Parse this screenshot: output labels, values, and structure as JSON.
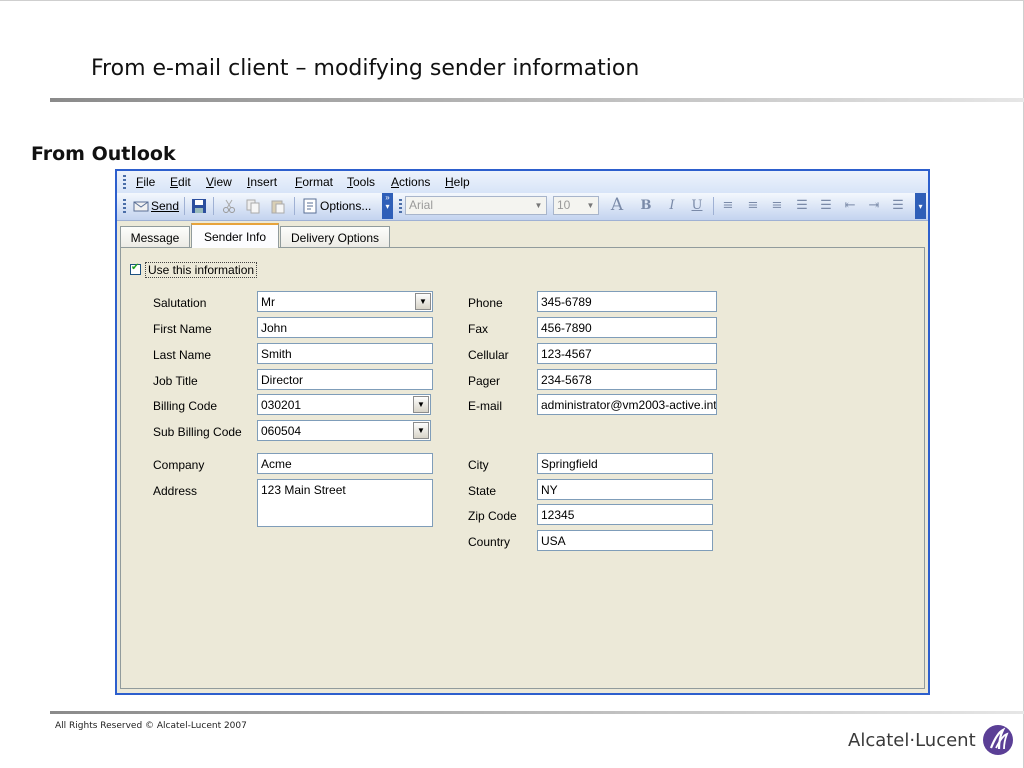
{
  "slide": {
    "title": "From e-mail client – modifying sender information",
    "section_heading": "From Outlook",
    "footer": {
      "copyright": "All Rights Reserved © Alcatel-Lucent 2007",
      "brand": "Alcatel·Lucent"
    }
  },
  "menubar": {
    "items": [
      {
        "label": "File"
      },
      {
        "label": "Edit"
      },
      {
        "label": "View"
      },
      {
        "label": "Insert"
      },
      {
        "label": "Format"
      },
      {
        "label": "Tools"
      },
      {
        "label": "Actions"
      },
      {
        "label": "Help"
      }
    ]
  },
  "toolbar": {
    "send_label": "Send",
    "options_label": "Options...",
    "font_name": "Arial",
    "font_size": "10",
    "format_icons": [
      "font-color-icon",
      "bold-icon",
      "italic-icon",
      "underline-icon",
      "align-left-icon",
      "align-center-icon",
      "align-right-icon",
      "bullets-icon",
      "numbering-icon",
      "decrease-indent-icon",
      "increase-indent-icon",
      "line-style-icon"
    ],
    "format_glyphs": [
      "A",
      "B",
      "I",
      "U",
      "≡",
      "≡",
      "≡",
      "☰",
      "☰",
      "⇤",
      "⇥",
      "☰"
    ]
  },
  "tabs": [
    {
      "label": "Message",
      "active": false
    },
    {
      "label": "Sender Info",
      "active": true
    },
    {
      "label": "Delivery Options",
      "active": false
    }
  ],
  "form": {
    "use_info_label": "Use this information",
    "use_info_checked": true,
    "left": [
      {
        "label": "Salutation",
        "value": "Mr",
        "type": "dropdown"
      },
      {
        "label": "First Name",
        "value": "John",
        "type": "text"
      },
      {
        "label": "Last Name",
        "value": "Smith",
        "type": "text"
      },
      {
        "label": "Job Title",
        "value": "Director",
        "type": "text"
      },
      {
        "label": "Billing Code",
        "value": "030201",
        "type": "dropdown"
      },
      {
        "label": "Sub Billing Code",
        "value": "060504",
        "type": "dropdown"
      },
      {
        "label": "Company",
        "value": "Acme",
        "type": "text"
      },
      {
        "label": "Address",
        "value": "123 Main Street",
        "type": "textarea"
      }
    ],
    "right": [
      {
        "label": "Phone",
        "value": "345-6789"
      },
      {
        "label": "Fax",
        "value": "456-7890"
      },
      {
        "label": "Cellular",
        "value": "123-4567"
      },
      {
        "label": "Pager",
        "value": "234-5678"
      },
      {
        "label": "E-mail",
        "value": "administrator@vm2003-active.inte"
      },
      {
        "label": "City",
        "value": "Springfield"
      },
      {
        "label": "State",
        "value": "NY"
      },
      {
        "label": "Zip Code",
        "value": "12345"
      },
      {
        "label": "Country",
        "value": "USA"
      }
    ]
  }
}
